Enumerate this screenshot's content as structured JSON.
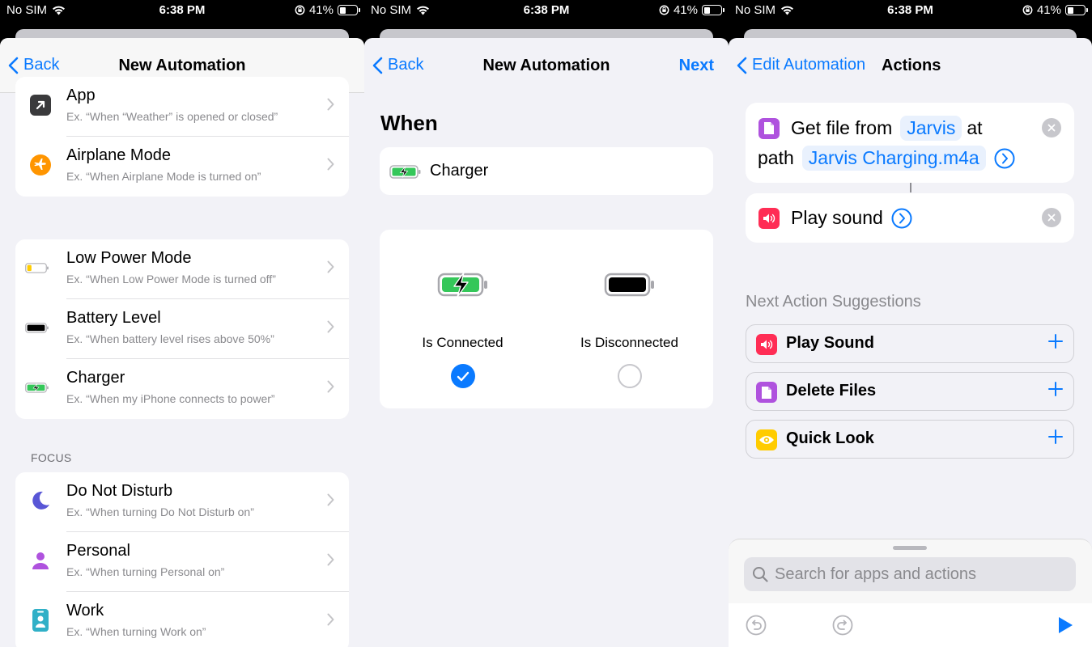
{
  "status": {
    "carrier": "No SIM",
    "time": "6:38 PM",
    "battery_percent": "41%",
    "battery_level": 0.41
  },
  "screen1": {
    "back_label": "Back",
    "title": "New Automation",
    "group1": [
      {
        "icon": "arrow-up-right-icon",
        "title": "App",
        "subtitle": "Ex. “When “Weather” is opened or closed”"
      },
      {
        "icon": "airplane-icon",
        "title": "Airplane Mode",
        "subtitle": "Ex. “When Airplane Mode is turned on”"
      }
    ],
    "group2": [
      {
        "icon": "low-power-battery-icon",
        "title": "Low Power Mode",
        "subtitle": "Ex. “When Low Power Mode is turned off”"
      },
      {
        "icon": "battery-full-icon",
        "title": "Battery Level",
        "subtitle": "Ex. “When battery level rises above 50%”"
      },
      {
        "icon": "charging-battery-icon",
        "title": "Charger",
        "subtitle": "Ex. “When my iPhone connects to power”"
      }
    ],
    "focus_section_label": "FOCUS",
    "group3": [
      {
        "icon": "moon-icon",
        "title": "Do Not Disturb",
        "subtitle": "Ex. “When turning Do Not Disturb on”"
      },
      {
        "icon": "person-icon",
        "title": "Personal",
        "subtitle": "Ex. “When turning Personal on”"
      },
      {
        "icon": "badge-icon",
        "title": "Work",
        "subtitle": "Ex. “When turning Work on”"
      }
    ]
  },
  "screen2": {
    "back_label": "Back",
    "title": "New Automation",
    "next_label": "Next",
    "when_heading": "When",
    "trigger_label": "Charger",
    "options": [
      {
        "label": "Is Connected",
        "selected": true
      },
      {
        "label": "Is Disconnected",
        "selected": false
      }
    ]
  },
  "screen3": {
    "back_label": "Edit Automation",
    "title": "Actions",
    "action1": {
      "prefix": "Get file from",
      "folder_token": "Jarvis",
      "at_label": "at",
      "path_label": "path",
      "path_token": "Jarvis Charging.m4a"
    },
    "action2": {
      "label": "Play sound"
    },
    "suggestions_heading": "Next Action Suggestions",
    "suggestions": [
      {
        "label": "Play Sound",
        "icon": "speaker-icon",
        "color": "#ff2d55"
      },
      {
        "label": "Delete Files",
        "icon": "document-icon",
        "color": "#af52de"
      },
      {
        "label": "Quick Look",
        "icon": "eye-icon",
        "color": "#ffcc00"
      }
    ],
    "search_placeholder": "Search for apps and actions"
  },
  "colors": {
    "accent": "#0a7aff",
    "files_purple": "#af52de",
    "sound_pink": "#ff2d55",
    "quicklook_yellow": "#ffcc00",
    "charge_green": "#34c759",
    "airplane_orange": "#ff9500",
    "moon_indigo": "#5856d6",
    "work_teal": "#30b0c7"
  }
}
